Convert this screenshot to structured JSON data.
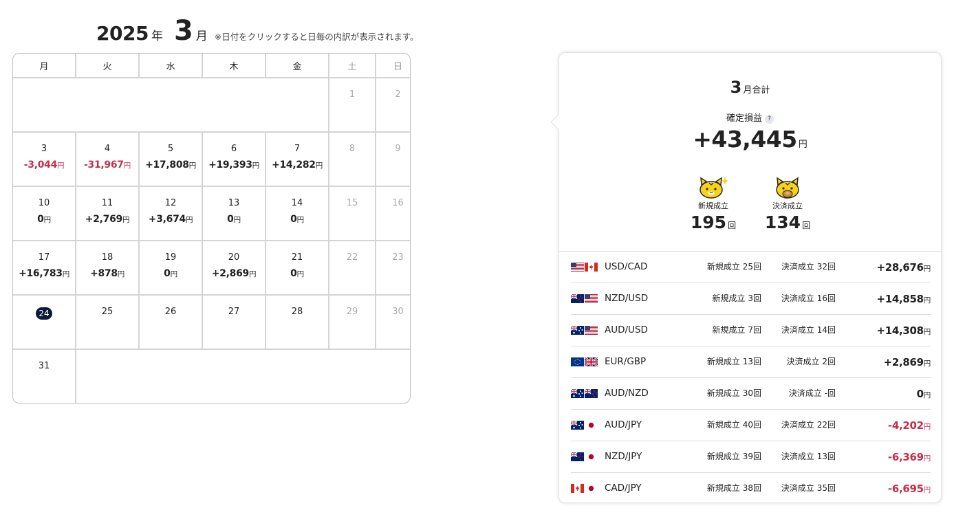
{
  "header": {
    "year": "2025",
    "year_unit": "年",
    "month": "3",
    "month_unit": "月",
    "note": "※日付をクリックすると日毎の内訳が表示されます。"
  },
  "calendar": {
    "weekdays": [
      "月",
      "火",
      "水",
      "木",
      "金",
      "土",
      "日"
    ],
    "currency": "円",
    "weeks": [
      [
        null,
        null,
        null,
        null,
        null,
        {
          "day": "1",
          "weekend": true
        },
        {
          "day": "2",
          "weekend": true
        }
      ],
      [
        {
          "day": "3",
          "amount": "-3,044",
          "negative": true
        },
        {
          "day": "4",
          "amount": "-31,967",
          "negative": true
        },
        {
          "day": "5",
          "amount": "+17,808"
        },
        {
          "day": "6",
          "amount": "+19,393"
        },
        {
          "day": "7",
          "amount": "+14,282"
        },
        {
          "day": "8",
          "weekend": true
        },
        {
          "day": "9",
          "weekend": true
        }
      ],
      [
        {
          "day": "10",
          "amount": "0"
        },
        {
          "day": "11",
          "amount": "+2,769"
        },
        {
          "day": "12",
          "amount": "+3,674"
        },
        {
          "day": "13",
          "amount": "0"
        },
        {
          "day": "14",
          "amount": "0"
        },
        {
          "day": "15",
          "weekend": true
        },
        {
          "day": "16",
          "weekend": true
        }
      ],
      [
        {
          "day": "17",
          "amount": "+16,783"
        },
        {
          "day": "18",
          "amount": "+878"
        },
        {
          "day": "19",
          "amount": "0"
        },
        {
          "day": "20",
          "amount": "+2,869"
        },
        {
          "day": "21",
          "amount": "0"
        },
        {
          "day": "22",
          "weekend": true
        },
        {
          "day": "23",
          "weekend": true
        }
      ],
      [
        {
          "day": "24",
          "today": true
        },
        {
          "day": "25"
        },
        {
          "day": "26"
        },
        {
          "day": "27"
        },
        {
          "day": "28"
        },
        {
          "day": "29",
          "weekend": true
        },
        {
          "day": "30",
          "weekend": true
        }
      ],
      [
        {
          "day": "31"
        },
        null,
        null,
        null,
        null,
        null,
        null
      ]
    ]
  },
  "summary": {
    "month": "3",
    "title_suffix": "月合計",
    "label": "確定損益",
    "help_icon": "?",
    "total": "+43,445",
    "currency": "円",
    "new_label": "新規成立",
    "new_count": "195",
    "settle_label": "決済成立",
    "settle_count": "134",
    "count_unit": "回"
  },
  "pairs": [
    {
      "name": "USD/CAD",
      "flags": [
        "us",
        "ca"
      ],
      "open": "新規成立 25回",
      "close": "決済成立 32回",
      "profit": "+28,676",
      "negative": false
    },
    {
      "name": "NZD/USD",
      "flags": [
        "nz",
        "us"
      ],
      "open": "新規成立 3回",
      "close": "決済成立 16回",
      "profit": "+14,858",
      "negative": false
    },
    {
      "name": "AUD/USD",
      "flags": [
        "au",
        "us"
      ],
      "open": "新規成立 7回",
      "close": "決済成立 14回",
      "profit": "+14,308",
      "negative": false
    },
    {
      "name": "EUR/GBP",
      "flags": [
        "eu",
        "gb"
      ],
      "open": "新規成立 13回",
      "close": "決済成立 2回",
      "profit": "+2,869",
      "negative": false
    },
    {
      "name": "AUD/NZD",
      "flags": [
        "au",
        "nz"
      ],
      "open": "新規成立 30回",
      "close": "決済成立 -回",
      "profit": "0",
      "negative": false
    },
    {
      "name": "AUD/JPY",
      "flags": [
        "au",
        "jp"
      ],
      "open": "新規成立 40回",
      "close": "決済成立 22回",
      "profit": "-4,202",
      "negative": true
    },
    {
      "name": "NZD/JPY",
      "flags": [
        "nz",
        "jp"
      ],
      "open": "新規成立 39回",
      "close": "決済成立 13回",
      "profit": "-6,369",
      "negative": true
    },
    {
      "name": "CAD/JPY",
      "flags": [
        "ca",
        "jp"
      ],
      "open": "新規成立 38回",
      "close": "決済成立 35回",
      "profit": "-6,695",
      "negative": true
    }
  ],
  "colors": {
    "negative": "#c62f4a",
    "today_badge": "#0b1b33",
    "mascot": "#f7d21a"
  },
  "icons": {
    "mascot_new": "tiger-mascot-sparkle-icon",
    "mascot_settle": "tiger-mascot-coin-icon",
    "help": "question-icon"
  }
}
